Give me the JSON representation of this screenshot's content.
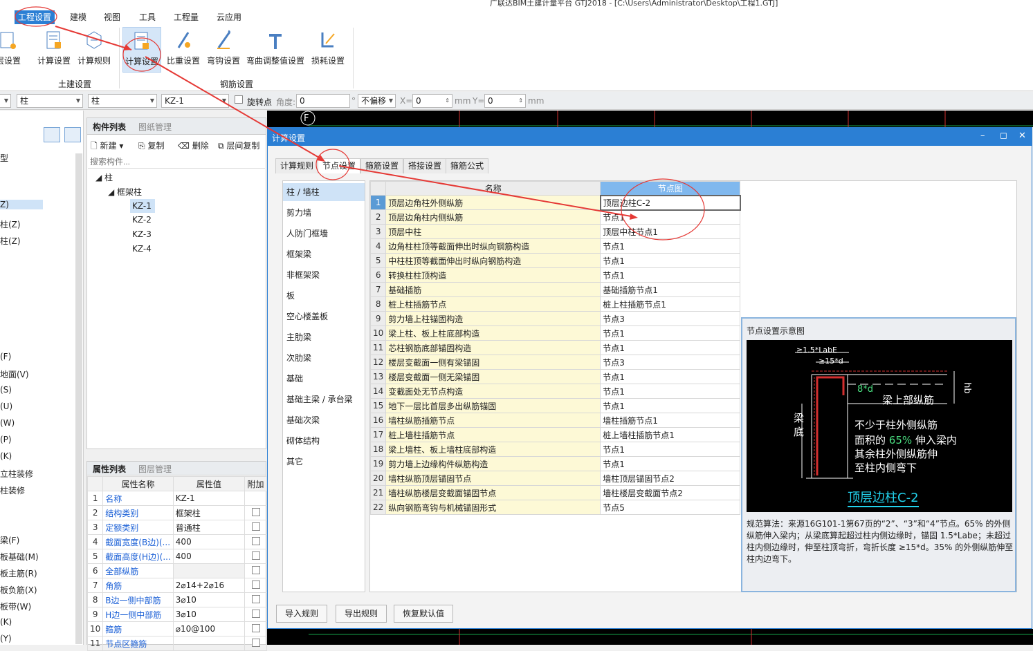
{
  "app_title": "广联达BIM土建计量平台 GTJ2018 - [C:\\Users\\Administrator\\Desktop\\工程1.GTJ]",
  "menu": [
    "工程设置",
    "建模",
    "视图",
    "工具",
    "工程量",
    "云应用"
  ],
  "ribbon": {
    "cut_label": "层设置",
    "buttons": [
      "计算设置",
      "计算规则",
      "计算设置",
      "比重设置",
      "弯钩设置",
      "弯曲调整值设置",
      "损耗设置"
    ],
    "groups": [
      "土建设置",
      "钢筋设置"
    ]
  },
  "toolbar": {
    "combo1": "柱",
    "combo2": "柱",
    "combo3": "KZ-1",
    "rotate_label": "旋转点",
    "angle_label": "角度:",
    "angle_value": "0",
    "degree_sign": "°",
    "offset_value": "不偏移",
    "x_label": "X=",
    "x_value": "0",
    "mm1": "mm",
    "y_label": "Y=",
    "y_value": "0",
    "mm2": "mm"
  },
  "left_pane": {
    "items_top": [
      "型",
      "Z)",
      "柱(Z)",
      "柱(Z)"
    ],
    "items_bottom": [
      "(F)",
      "地面(V)",
      "(S)",
      "(U)",
      "(W)",
      "(P)",
      "(K)",
      "立柱装修",
      "柱装修"
    ],
    "items_bottom2": [
      "梁(F)",
      "板基础(M)",
      "板主筋(R)",
      "板负筋(X)",
      "板带(W)",
      "(K)",
      "(Y)"
    ]
  },
  "component_list": {
    "tabs": [
      "构件列表",
      "图纸管理"
    ],
    "new_btn": "新建",
    "copy_btn": "复制",
    "delete_btn": "删除",
    "floor_copy_btn": "层间复制",
    "search_placeholder": "搜索构件...",
    "tree_root": "柱",
    "tree_child": "框架柱",
    "items": [
      "KZ-1",
      "KZ-2",
      "KZ-3",
      "KZ-4"
    ]
  },
  "property_panel": {
    "tabs": [
      "属性列表",
      "图层管理"
    ],
    "headers": [
      "属性名称",
      "属性值",
      "附加"
    ],
    "rows": [
      {
        "n": "1",
        "name": "名称",
        "value": "KZ-1",
        "chk": false
      },
      {
        "n": "2",
        "name": "结构类别",
        "value": "框架柱",
        "chk": true
      },
      {
        "n": "3",
        "name": "定额类别",
        "value": "普通柱",
        "chk": true
      },
      {
        "n": "4",
        "name": "截面宽度(B边)(...",
        "value": "400",
        "chk": true
      },
      {
        "n": "5",
        "name": "截面高度(H边)(...",
        "value": "400",
        "chk": true
      },
      {
        "n": "6",
        "name": "全部纵筋",
        "value": "",
        "chk": true
      },
      {
        "n": "7",
        "name": "角筋",
        "value": "2⌀14+2⌀16",
        "chk": true
      },
      {
        "n": "8",
        "name": "B边一侧中部筋",
        "value": "3⌀10",
        "chk": true
      },
      {
        "n": "9",
        "name": "H边一侧中部筋",
        "value": "3⌀10",
        "chk": true
      },
      {
        "n": "10",
        "name": "箍筋",
        "value": "⌀10@100",
        "chk": true
      },
      {
        "n": "11",
        "name": "节点区箍筋",
        "value": "",
        "chk": true
      }
    ]
  },
  "dialog": {
    "title": "计算设置",
    "tabs": [
      "计算规则",
      "节点设置",
      "箍筋设置",
      "搭接设置",
      "箍筋公式"
    ],
    "categories": [
      "柱 / 墙柱",
      "剪力墙",
      "人防门框墙",
      "框架梁",
      "非框架梁",
      "板",
      "空心楼盖板",
      "主肋梁",
      "次肋梁",
      "基础",
      "基础主梁 / 承台梁",
      "基础次梁",
      "砌体结构",
      "其它"
    ],
    "grid_headers": [
      "名称",
      "节点图"
    ],
    "rows": [
      {
        "n": "1",
        "name": "顶层边角柱外侧纵筋",
        "node": "顶层边柱C-2"
      },
      {
        "n": "2",
        "name": "顶层边角柱内侧纵筋",
        "node": "节点1"
      },
      {
        "n": "3",
        "name": "顶层中柱",
        "node": "顶层中柱节点1"
      },
      {
        "n": "4",
        "name": "边角柱柱顶等截面伸出时纵向钢筋构造",
        "node": "节点1"
      },
      {
        "n": "5",
        "name": "中柱柱顶等截面伸出时纵向钢筋构造",
        "node": "节点1"
      },
      {
        "n": "6",
        "name": "转换柱柱顶构造",
        "node": "节点1"
      },
      {
        "n": "7",
        "name": "基础插筋",
        "node": "基础插筋节点1"
      },
      {
        "n": "8",
        "name": "桩上柱插筋节点",
        "node": "桩上柱插筋节点1"
      },
      {
        "n": "9",
        "name": "剪力墙上柱锚固构造",
        "node": "节点3"
      },
      {
        "n": "10",
        "name": "梁上柱、板上柱底部构造",
        "node": "节点1"
      },
      {
        "n": "11",
        "name": "芯柱钢筋底部锚固构造",
        "node": "节点1"
      },
      {
        "n": "12",
        "name": "楼层变截面一侧有梁锚固",
        "node": "节点3"
      },
      {
        "n": "13",
        "name": "楼层变截面一侧无梁锚固",
        "node": "节点1"
      },
      {
        "n": "14",
        "name": "变截面处无节点构造",
        "node": "节点1"
      },
      {
        "n": "15",
        "name": "地下一层比首层多出纵筋锚固",
        "node": "节点1"
      },
      {
        "n": "16",
        "name": "墙柱纵筋插筋节点",
        "node": "墙柱插筋节点1"
      },
      {
        "n": "17",
        "name": "桩上墙柱插筋节点",
        "node": "桩上墙柱插筋节点1"
      },
      {
        "n": "18",
        "name": "梁上墙柱、板上墙柱底部构造",
        "node": "节点1"
      },
      {
        "n": "19",
        "name": "剪力墙上边缘构件纵筋构造",
        "node": "节点1"
      },
      {
        "n": "20",
        "name": "墙柱纵筋顶层锚固节点",
        "node": "墙柱顶层锚固节点2"
      },
      {
        "n": "21",
        "name": "墙柱纵筋楼层变截面锚固节点",
        "node": "墙柱楼层变截面节点2"
      },
      {
        "n": "22",
        "name": "纵向钢筋弯钩与机械锚固形式",
        "node": "节点5"
      }
    ],
    "preview": {
      "title": "节点设置示意图",
      "diagram_labels": {
        "lab": "≥1.5*LabE",
        "d15": "≥15*d",
        "d8": "8*d",
        "beam_top": "梁上部纵筋",
        "hb": "hb",
        "beam_bottom_1": "梁",
        "beam_bottom_2": "底",
        "note1": "不少于柱外侧纵筋",
        "note2a": "面积的",
        "note2b": "65%",
        "note2c": "伸入梁内",
        "note3": "其余柱外侧纵筋伸",
        "note4": "至柱内侧弯下",
        "caption": "顶层边柱C-2"
      },
      "description": "规范算法：来源16G101-1第67页的“2”、“3”和“4”节点。65% 的外侧纵筋伸入梁内；从梁底算起超过柱内侧边缘时，锚固 1.5*Labe；未超过柱内侧边缘时，伸至柱顶弯折，弯折长度 ≥15*d。35% 的外侧纵筋伸至柱内边弯下。"
    },
    "buttons": [
      "导入规则",
      "导出规则",
      "恢复默认值"
    ]
  },
  "canvas_marker": "F",
  "colors": {
    "accent": "#2b7fd4",
    "annotation": "#e53935",
    "name_cell": "#fdf9d6",
    "node_header": "#80b8ee"
  }
}
